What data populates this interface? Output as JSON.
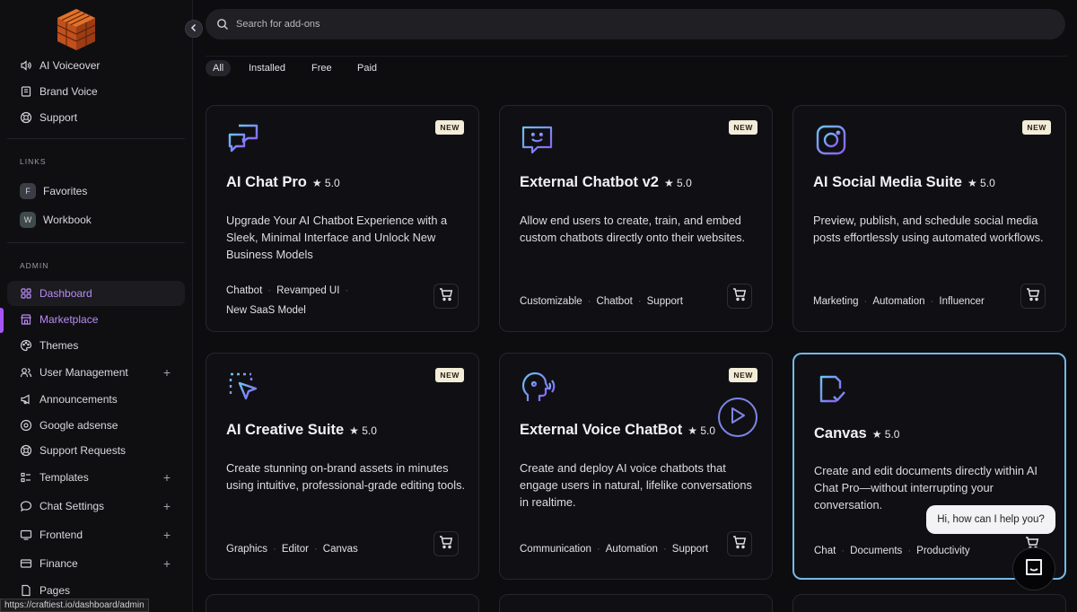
{
  "sidebar": {
    "items_top": [
      {
        "label": "AI Voiceover",
        "icon": "speaker-icon"
      },
      {
        "label": "Brand Voice",
        "icon": "book-icon"
      },
      {
        "label": "Support",
        "icon": "lifebuoy-icon"
      }
    ],
    "links_label": "LINKS",
    "links": [
      {
        "letter": "F",
        "label": "Favorites"
      },
      {
        "letter": "W",
        "label": "Workbook"
      }
    ],
    "admin_label": "ADMIN",
    "admin_items": [
      {
        "label": "Dashboard",
        "icon": "grid-icon"
      },
      {
        "label": "Marketplace",
        "icon": "store-icon"
      },
      {
        "label": "Themes",
        "icon": "palette-icon"
      },
      {
        "label": "User Management",
        "icon": "users-icon"
      },
      {
        "label": "Announcements",
        "icon": "megaphone-icon"
      },
      {
        "label": "Google adsense",
        "icon": "ad-icon"
      },
      {
        "label": "Support Requests",
        "icon": "lifebuoy-icon"
      },
      {
        "label": "Templates",
        "icon": "list-icon"
      },
      {
        "label": "Chat Settings",
        "icon": "chat-icon"
      },
      {
        "label": "Frontend",
        "icon": "monitor-icon"
      },
      {
        "label": "Finance",
        "icon": "card-icon"
      },
      {
        "label": "Pages",
        "icon": "page-icon"
      }
    ],
    "expand_symbol": "+"
  },
  "status_url": "https://craftiest.io/dashboard/admin",
  "search": {
    "placeholder": "Search for add-ons"
  },
  "filters": [
    "All",
    "Installed",
    "Free",
    "Paid"
  ],
  "new_badge": "NEW",
  "cards": [
    {
      "title": "AI Chat Pro",
      "rating": "★ 5.0",
      "desc": "Upgrade Your AI Chatbot Experience with a Sleek, Minimal Interface and Unlock New Business Models",
      "tags": [
        "Chatbot",
        "Revamped UI",
        "New SaaS Model"
      ],
      "icon": "chat-bubbles-icon"
    },
    {
      "title": "External Chatbot v2",
      "rating": "★ 5.0",
      "desc": "Allow end users to create, train, and embed custom chatbots directly onto their websites.",
      "tags": [
        "Customizable",
        "Chatbot",
        "Support"
      ],
      "icon": "smile-chat-icon"
    },
    {
      "title": "AI Social Media Suite",
      "rating": "★ 5.0",
      "desc": "Preview, publish, and schedule social media posts effortlessly using automated workflows.",
      "tags": [
        "Marketing",
        "Automation",
        "Influencer"
      ],
      "icon": "instagram-icon"
    },
    {
      "title": "AI Creative Suite",
      "rating": "★ 5.0",
      "desc": "Create stunning on-brand assets in minutes using intuitive, professional-grade editing tools.",
      "tags": [
        "Graphics",
        "Editor",
        "Canvas"
      ],
      "icon": "select-cursor-icon"
    },
    {
      "title": "External Voice ChatBot",
      "rating": "★ 5.0",
      "desc": "Create and deploy AI voice chatbots that engage users in natural, lifelike conversations in realtime.",
      "tags": [
        "Communication",
        "Automation",
        "Support"
      ],
      "icon": "voice-head-icon"
    },
    {
      "title": "Canvas",
      "rating": "★ 5.0",
      "desc": "Create and edit documents directly within AI Chat Pro—without interrupting your conversation.",
      "tags": [
        "Chat",
        "Documents",
        "Productivity"
      ],
      "icon": "doc-check-icon"
    }
  ],
  "chat_widget": {
    "greeting": "Hi, how can I help you?"
  },
  "colors": {
    "accent": "#a855f7",
    "highlight_border": "#74b9e8",
    "icon_gradient_start": "#6ec3f4",
    "icon_gradient_end": "#8b5cf6"
  }
}
